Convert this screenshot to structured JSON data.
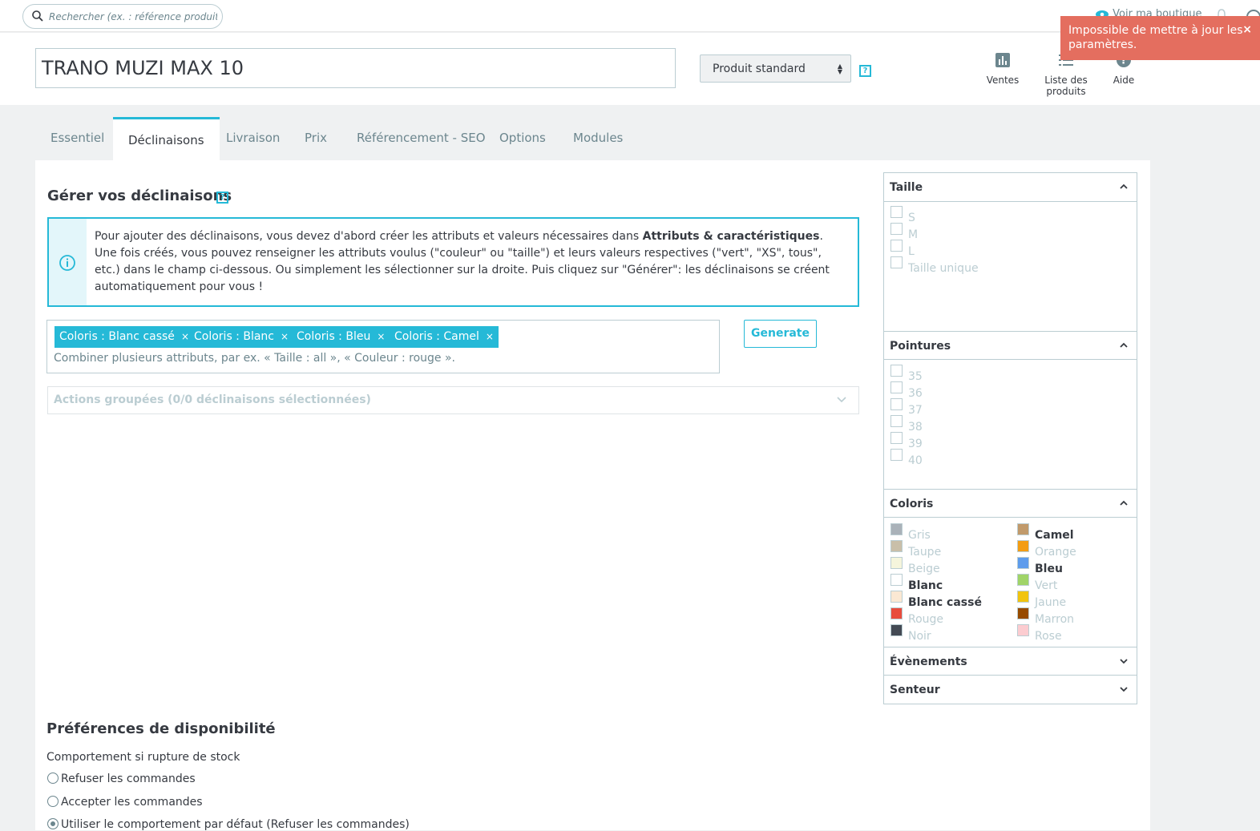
{
  "search": {
    "placeholder": "Rechercher (ex. : référence produit, nom"
  },
  "topbar": {
    "view_shop": "Voir ma boutique"
  },
  "product": {
    "name": "TRANO MUZI MAX 10",
    "type": "Produit standard"
  },
  "header_actions": [
    {
      "label": "Ventes",
      "icon": "bar-chart-icon"
    },
    {
      "label": "Liste des produits",
      "icon": "list-icon"
    },
    {
      "label": "Aide",
      "icon": "help-circle-icon"
    }
  ],
  "toast": {
    "message": "Impossible de mettre à jour les paramètres.",
    "close": "×"
  },
  "tabs": [
    "Essentiel",
    "Déclinaisons",
    "Livraison",
    "Prix",
    "Référencement - SEO",
    "Options",
    "Modules"
  ],
  "active_tab": "Déclinaisons",
  "combinations": {
    "title": "Gérer vos déclinaisons",
    "help": "?",
    "info_part1": "Pour ajouter des déclinaisons, vous devez d'abord créer les attributs et valeurs nécessaires dans ",
    "info_link": "Attributs & caractéristiques",
    "info_part2": ".",
    "info_line2": "Une fois créés, vous pouvez renseigner les attributs voulus (\"couleur\" ou \"taille\") et leurs valeurs respectives (\"vert\", \"XS\", tous\", etc.) dans le champ ci-dessous. Ou simplement les sélectionner sur la droite. Puis cliquez sur \"Générer\": les déclinaisons se créent automatiquement pour vous !",
    "tokens": [
      "Coloris : Blanc cassé",
      "Coloris : Blanc",
      "Coloris : Bleu",
      "Coloris : Camel"
    ],
    "token_remove": "×",
    "input_hint": "Combiner plusieurs attributs, par ex. « Taille : all », « Couleur : rouge ».",
    "generate_label": "Generate",
    "bulk_label": "Actions groupées (0/0 déclinaisons sélectionnées)"
  },
  "filters": {
    "taille": {
      "title": "Taille",
      "options": [
        "S",
        "M",
        "L",
        "Taille unique"
      ]
    },
    "pointures": {
      "title": "Pointures",
      "options": [
        "35",
        "36",
        "37",
        "38",
        "39",
        "40"
      ]
    },
    "coloris": {
      "title": "Coloris",
      "left": [
        {
          "name": "Gris",
          "color": "#aab2b9",
          "selected": false
        },
        {
          "name": "Taupe",
          "color": "#c9bfa9",
          "selected": false
        },
        {
          "name": "Beige",
          "color": "#f5f5dc",
          "selected": false
        },
        {
          "name": "Blanc",
          "color": "#ffffff",
          "selected": true
        },
        {
          "name": "Blanc cassé",
          "color": "#fbe8d3",
          "selected": true
        },
        {
          "name": "Rouge",
          "color": "#e84c3d",
          "selected": false
        },
        {
          "name": "Noir",
          "color": "#434a54",
          "selected": false
        }
      ],
      "right": [
        {
          "name": "Camel",
          "color": "#c19a6b",
          "selected": true
        },
        {
          "name": "Orange",
          "color": "#f39d13",
          "selected": false
        },
        {
          "name": "Bleu",
          "color": "#5d9cec",
          "selected": true
        },
        {
          "name": "Vert",
          "color": "#a0d468",
          "selected": false
        },
        {
          "name": "Jaune",
          "color": "#f1c40f",
          "selected": false
        },
        {
          "name": "Marron",
          "color": "#964b00",
          "selected": false
        },
        {
          "name": "Rose",
          "color": "#fcccd0",
          "selected": false
        }
      ]
    },
    "evenements": {
      "title": "Évènements"
    },
    "senteur": {
      "title": "Senteur"
    }
  },
  "availability": {
    "title": "Préférences de disponibilité",
    "label": "Comportement si rupture de stock",
    "options": [
      "Refuser les commandes",
      "Accepter les commandes",
      "Utiliser le comportement par défaut (Refuser les commandes)"
    ],
    "selected_index": 2
  },
  "colors": {
    "accent": "#25b9d7",
    "toast": "#e46e5f",
    "text": "#363a41",
    "muted": "#bbcdd2"
  }
}
